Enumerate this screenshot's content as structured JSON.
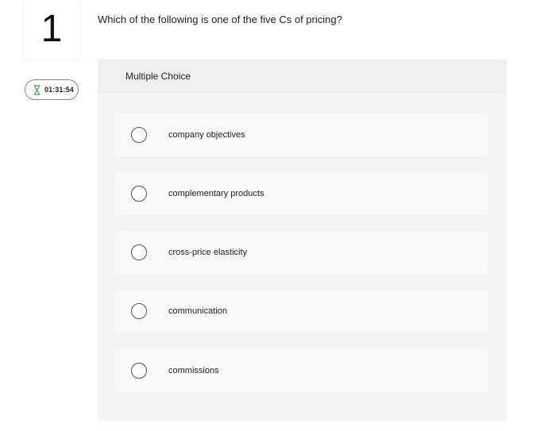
{
  "question": {
    "number": "1",
    "text": "Which of the following is one of the five Cs of pricing?"
  },
  "timer": {
    "icon": "hourglass-icon",
    "value": "01:31:54"
  },
  "panel": {
    "header": "Multiple Choice",
    "choices": [
      {
        "label": "company objectives",
        "selected": false
      },
      {
        "label": "complementary products",
        "selected": false
      },
      {
        "label": "cross-price elasticity",
        "selected": false
      },
      {
        "label": "communication",
        "selected": false
      },
      {
        "label": "commissions",
        "selected": false
      }
    ]
  },
  "colors": {
    "panel_bg": "#f4f4f4",
    "choice_bg": "#f9f9f9",
    "timer_border": "#7f8c7f",
    "hourglass": "#4a9a4a"
  }
}
